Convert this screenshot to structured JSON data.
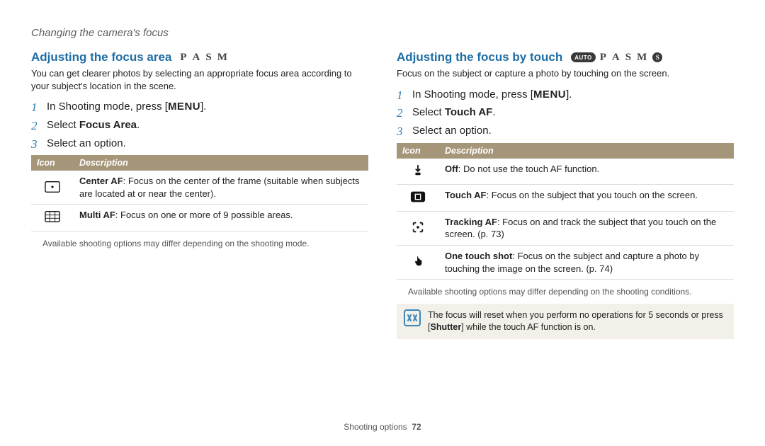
{
  "breadcrumb": "Changing the camera's focus",
  "footer": {
    "section": "Shooting options",
    "page": "72"
  },
  "left": {
    "title": "Adjusting the focus area",
    "modes": [
      "P",
      "A",
      "S",
      "M"
    ],
    "intro": "You can get clearer photos by selecting an appropriate focus area according to your subject's location in the scene.",
    "steps": {
      "s1a": "In Shooting mode, press [",
      "s1menu": "MENU",
      "s1b": "].",
      "s2a": "Select ",
      "s2bold": "Focus Area",
      "s2b": ".",
      "s3": "Select an option."
    },
    "table": {
      "hIcon": "Icon",
      "hDesc": "Description",
      "rows": [
        {
          "icon": "center-af-icon",
          "bold": "Center AF",
          "text": ": Focus on the center of the frame (suitable when subjects are located at or near the center)."
        },
        {
          "icon": "multi-af-icon",
          "bold": "Multi AF",
          "text": ": Focus on one or more of 9 possible areas."
        }
      ]
    },
    "note": "Available shooting options may differ depending on the shooting mode."
  },
  "right": {
    "title": "Adjusting the focus by touch",
    "modes_auto": "AUTO",
    "modes": [
      "P",
      "A",
      "S",
      "M"
    ],
    "modes_s": "S",
    "intro": "Focus on the subject or capture a photo by touching on the screen.",
    "steps": {
      "s1a": "In Shooting mode, press [",
      "s1menu": "MENU",
      "s1b": "].",
      "s2a": "Select ",
      "s2bold": "Touch AF",
      "s2b": ".",
      "s3": "Select an option."
    },
    "table": {
      "hIcon": "Icon",
      "hDesc": "Description",
      "rows": [
        {
          "icon": "off-icon",
          "bold": "Off",
          "text": ": Do not use the touch AF function."
        },
        {
          "icon": "touch-af-icon",
          "bold": "Touch AF",
          "text": ": Focus on the subject that you touch on the screen."
        },
        {
          "icon": "tracking-af-icon",
          "bold": "Tracking AF",
          "text": ": Focus on and track the subject that you touch on the screen. (p. 73)"
        },
        {
          "icon": "one-touch-icon",
          "bold": "One touch shot",
          "text": ": Focus on the subject and capture a photo by touching the image on the screen. (p. 74)"
        }
      ]
    },
    "note": "Available shooting options may differ depending on the shooting conditions.",
    "callout_a": "The focus will reset when you perform no operations for 5 seconds or press [",
    "callout_bold": "Shutter",
    "callout_b": "] while the touch AF function is on."
  }
}
